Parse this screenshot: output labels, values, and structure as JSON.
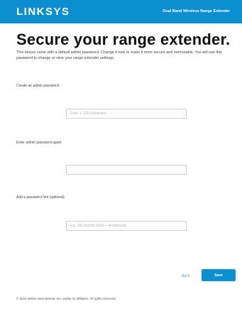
{
  "header": {
    "logo": "LINKSYS",
    "product": "Dual Band Wireless Range Extender"
  },
  "page": {
    "title": "Secure your range extender.",
    "description": "This device came with a default admin password. Change it now to make it more secure and memorable. You will use this password to change or view your range extender settings."
  },
  "form": {
    "admin_password": {
      "label": "Create an admin password:",
      "placeholder": "Enter 1-128 characters",
      "value": ""
    },
    "confirm_password": {
      "label": "Enter admin password again:",
      "placeholder": "",
      "value": ""
    },
    "password_hint": {
      "label": "Add a password hint (optional):",
      "placeholder": "e.g., My favorite book + anniversary",
      "value": ""
    }
  },
  "actions": {
    "back_label": "Back",
    "save_label": "Save"
  },
  "footer": {
    "copyright": "© 2016 Belkin International, Inc. and/or its affiliates. All rights reserved."
  },
  "colors": {
    "brand": "#0b8fd1",
    "link": "#4aa3d9"
  }
}
